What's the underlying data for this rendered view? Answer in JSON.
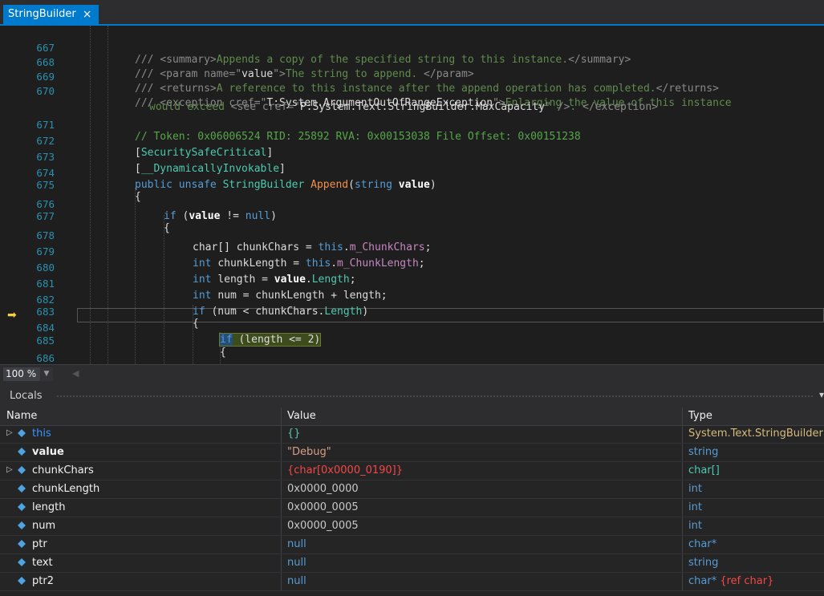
{
  "tab": {
    "title": "StringBuilder",
    "close": "×"
  },
  "code": {
    "lines": [
      {
        "n": "667",
        "html": "<span class='c-com'>/// &lt;summary&gt;Appends a copy of the specified string to this instance.&lt;/summary&gt;</span>"
      },
      {
        "n": "668",
        "html": "<span class='c-com'>/// &lt;param name=\"<span class='c-id'>value</span>\"&gt;The string to append. &lt;/param&gt;</span>"
      },
      {
        "n": "669",
        "html": "<span class='c-com'>/// &lt;returns&gt;A reference to this instance after the append operation has completed.&lt;/returns&gt;</span>"
      },
      {
        "n": "670",
        "html": "<span class='c-com'>/// &lt;exception cref=\"<span class='c-id'>T:System.ArgumentOutOfRangeException</span>\"&gt;Enlarging the value of this instance</span>"
      }
    ]
  },
  "zoom": {
    "value": "100 %"
  },
  "locals": {
    "title": "Locals",
    "columns": {
      "name": "Name",
      "value": "Value",
      "type": "Type"
    },
    "rows": [
      {
        "name": "this",
        "value": "{}",
        "type": "System.Text.StringBuilder"
      },
      {
        "name": "value",
        "value": "\"Debug\"",
        "type": "string"
      },
      {
        "name": "chunkChars",
        "value_a": "{char[0x0000_0190]}",
        "type": "char[]"
      },
      {
        "name": "chunkLength",
        "value": "0x0000_0000",
        "type": "int"
      },
      {
        "name": "length",
        "value": "0x0000_0005",
        "type": "int"
      },
      {
        "name": "num",
        "value": "0x0000_0005",
        "type": "int"
      },
      {
        "name": "ptr",
        "value": "null",
        "type": "char*"
      },
      {
        "name": "text",
        "value": "null",
        "type": "string"
      },
      {
        "name": "ptr2",
        "value": "null",
        "type_a": "char*",
        "type_b": "{ref char}"
      }
    ]
  }
}
